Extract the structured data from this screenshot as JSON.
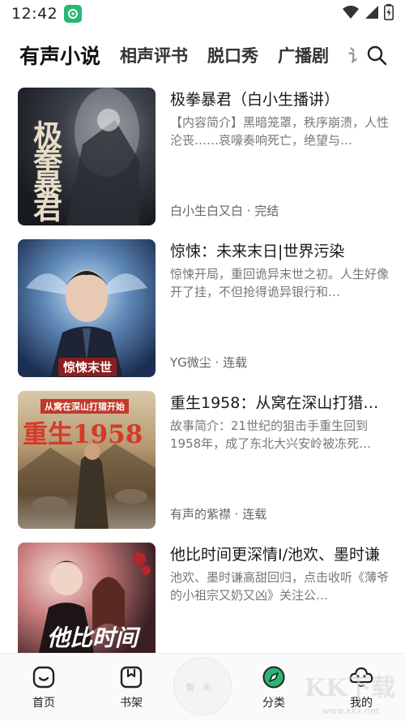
{
  "status_bar": {
    "time": "12:42",
    "notification_icon": "app-notification-icon",
    "icons": [
      "wifi-icon",
      "signal-icon",
      "battery-icon"
    ]
  },
  "tabs": [
    {
      "label": "有声小说",
      "active": true
    },
    {
      "label": "相声评书",
      "active": false
    },
    {
      "label": "脱口秀",
      "active": false
    },
    {
      "label": "广播剧",
      "active": false
    },
    {
      "label": "讠",
      "active": false
    }
  ],
  "search_icon": "search-icon",
  "books": [
    {
      "title": "极拳暴君（白小生播讲）",
      "description": "【内容简介】黑暗笼罩，秩序崩溃，人性沦丧……哀嚎奏响死亡，绝望与…",
      "meta": "白小生白又白 · 完结",
      "cover_text": "极拳暴君"
    },
    {
      "title": "惊悚：未来末日|世界污染",
      "description": "惊悚开局，重回诡异末世之初。人生好像开了挂，不但抢得诡异银行和…",
      "meta": "YG微尘 · 连载",
      "cover_text": "惊悚末世"
    },
    {
      "title": "重生1958：从窝在深山打猎…",
      "description": "故事简介：21世纪的狙击手重生回到1958年，成了东北大兴安岭被冻死…",
      "meta": "有声的紫襟 · 连载",
      "cover_text": "重生1958",
      "cover_banner": "从窝在深山打猎开始"
    },
    {
      "title": "他比时间更深情I/池欢、墨时谦",
      "description": "池欢、墨时谦高甜回归，点击收听《薄爷的小祖宗又奶又凶》关注公…",
      "meta": "",
      "cover_text": "他比时间"
    }
  ],
  "bottom_nav": {
    "items": [
      {
        "label": "首页",
        "icon": "home-icon"
      },
      {
        "label": "书架",
        "icon": "bookshelf-icon"
      },
      {
        "label": "分类",
        "icon": "compass-icon"
      },
      {
        "label": "我的",
        "icon": "profile-icon"
      }
    ],
    "play_button_label": "暂无"
  },
  "watermark": {
    "text": "KK下载",
    "url": "www.kkx.net"
  },
  "colors": {
    "accent_green": "#2bb673",
    "text_primary": "#1a1a1a",
    "text_secondary": "#777777"
  }
}
